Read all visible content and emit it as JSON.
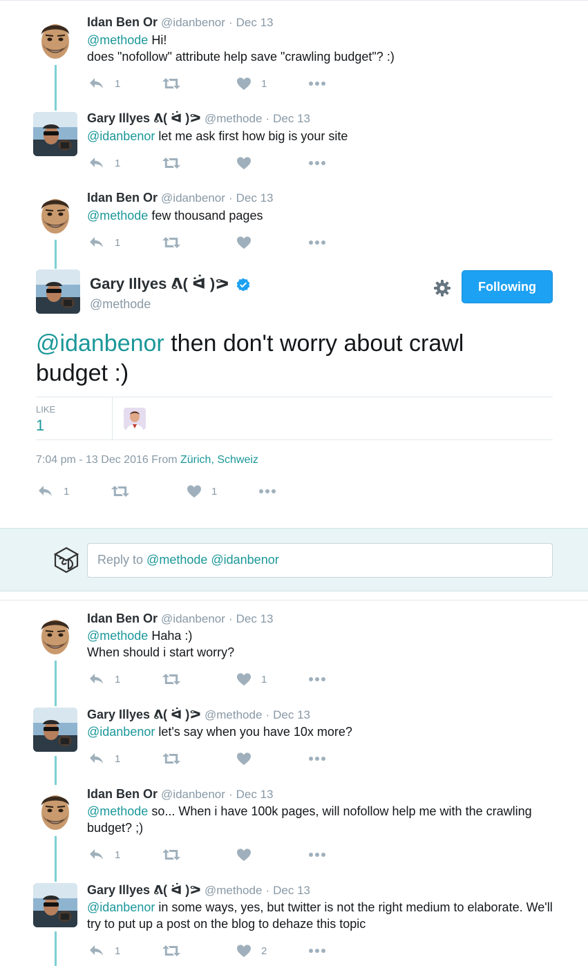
{
  "tweets_before": [
    {
      "name": "Idan Ben Or",
      "handle": "@idanbenor",
      "date": "Dec 13",
      "mention": "@methode",
      "text_after_mention": " Hi!",
      "line2": "does \"nofollow\" attribute help save \"crawling budget\"? :)",
      "reply_count": "1",
      "like_count": "1"
    },
    {
      "name": "Gary Illyes ᕕ( ᐛ )ᕗ",
      "handle": "@methode",
      "date": "Dec 13",
      "mention": "@idanbenor",
      "text_after_mention": " let me ask first how big is your site",
      "reply_count": "1",
      "like_count": ""
    },
    {
      "name": "Idan Ben Or",
      "handle": "@idanbenor",
      "date": "Dec 13",
      "mention": "@methode",
      "text_after_mention": " few thousand pages",
      "reply_count": "1",
      "like_count": ""
    }
  ],
  "main": {
    "name": "Gary Illyes ᕕ( ᐛ )ᕗ",
    "handle": "@methode",
    "follow_label": "Following",
    "mention": "@idanbenor",
    "text_after_mention": " then don't worry about crawl budget :)",
    "like_label": "LIKE",
    "like_count": "1",
    "time": "7:04 pm - 13 Dec 2016",
    "from_label": "From",
    "place": "Zürich, Schweiz",
    "reply_count": "1",
    "favorite_count": "1"
  },
  "reply_box": {
    "prefix": "Reply to ",
    "mentions": "@methode @idanbenor"
  },
  "tweets_after": [
    {
      "name": "Idan Ben Or",
      "handle": "@idanbenor",
      "date": "Dec 13",
      "mention": "@methode",
      "text_after_mention": " Haha  :)",
      "line2": "When should i start worry?",
      "reply_count": "1",
      "like_count": "1"
    },
    {
      "name": "Gary Illyes ᕕ( ᐛ )ᕗ",
      "handle": "@methode",
      "date": "Dec 13",
      "mention": "@idanbenor",
      "text_after_mention": " let's say when you have 10x more?",
      "reply_count": "1",
      "like_count": ""
    },
    {
      "name": "Idan Ben Or",
      "handle": "@idanbenor",
      "date": "Dec 13",
      "mention": "@methode",
      "text_after_mention": " so... When i have 100k pages, will nofollow help me with the crawling budget?  ;)",
      "reply_count": "1",
      "like_count": ""
    },
    {
      "name": "Gary Illyes ᕕ( ᐛ )ᕗ",
      "handle": "@methode",
      "date": "Dec 13",
      "mention": "@idanbenor",
      "text_after_mention": " in some ways, yes, but twitter is not the right medium to elaborate. We'll try to put up a post on the blog to dehaze this topic",
      "reply_count": "1",
      "like_count": "2"
    }
  ],
  "icons": {
    "reply": "reply-icon",
    "retweet": "retweet-icon",
    "like": "heart-icon",
    "more": "more-icon",
    "settings": "gear-icon",
    "verified": "verified-badge-icon"
  },
  "colors": {
    "mention": "#1b9799",
    "follow_button": "#1da1f2",
    "thread_line": "#7ecfd3",
    "muted": "#8899a6"
  },
  "separator": "·"
}
